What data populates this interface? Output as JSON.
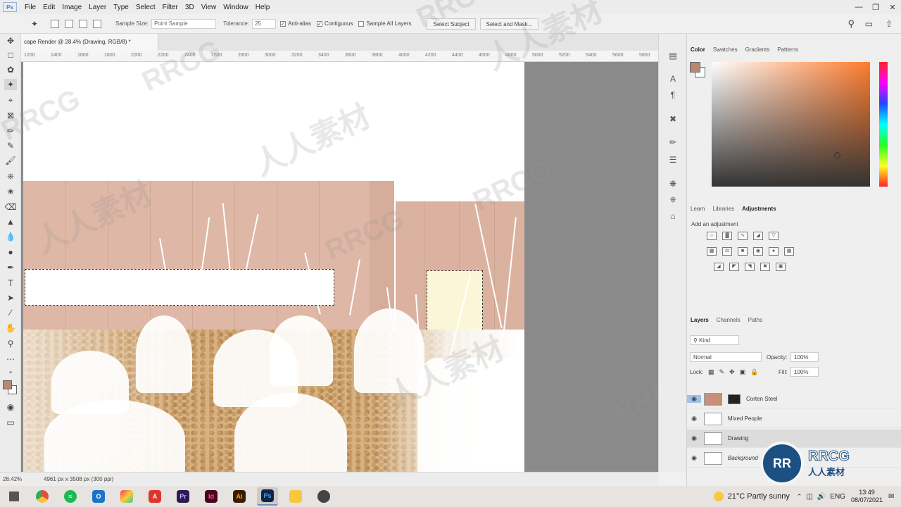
{
  "app": {
    "logo": "Ps",
    "menu": [
      "File",
      "Edit",
      "Image",
      "Layer",
      "Type",
      "Select",
      "Filter",
      "3D",
      "View",
      "Window",
      "Help"
    ]
  },
  "options": {
    "sample_size_label": "Sample Size:",
    "sample_size_value": "Point Sample",
    "tolerance_label": "Tolerance:",
    "tolerance_value": "25",
    "anti_alias": "Anti-alias",
    "contiguous": "Contiguous",
    "sample_all_layers": "Sample All Layers",
    "select_subject": "Select Subject",
    "select_and_mask": "Select and Mask..."
  },
  "document": {
    "tab_title": "cape Render @ 28.4% (Drawing, RGB/8) *",
    "ruler_ticks": [
      "1200",
      "1400",
      "1600",
      "1800",
      "2000",
      "2200",
      "2400",
      "2600",
      "2800",
      "3000",
      "3200",
      "3400",
      "3600",
      "3800",
      "4000",
      "4200",
      "4400",
      "4600",
      "4800",
      "5000",
      "5200",
      "5400",
      "5600",
      "5800"
    ],
    "zoom": "28.42%",
    "size": "4961 px x 3508 px (300 ppi)"
  },
  "color_panel": {
    "tabs": [
      "Color",
      "Swatches",
      "Gradients",
      "Patterns"
    ],
    "fg_color": "#b98772",
    "bg_color": "#ffffff"
  },
  "adjustments_panel": {
    "tabs": [
      "Learn",
      "Libraries",
      "Adjustments"
    ],
    "add_label": "Add an adjustment"
  },
  "layers_panel": {
    "tabs": [
      "Layers",
      "Channels",
      "Paths"
    ],
    "kind": "Kind",
    "blend_mode": "Normal",
    "opacity_label": "Opacity:",
    "opacity": "100%",
    "lock_label": "Lock:",
    "fill_label": "Fill:",
    "fill": "100%",
    "layers": [
      {
        "name": "Corten Steel"
      },
      {
        "name": "Mixed People"
      },
      {
        "name": "Drawing"
      },
      {
        "name": "Background"
      }
    ]
  },
  "watermark": {
    "brand": "RRCG",
    "cn": "人人素材"
  },
  "taskbar": {
    "weather": "21°C  Partly sunny",
    "language": "ENG",
    "time": "13:49",
    "date": "08/07/2021"
  }
}
